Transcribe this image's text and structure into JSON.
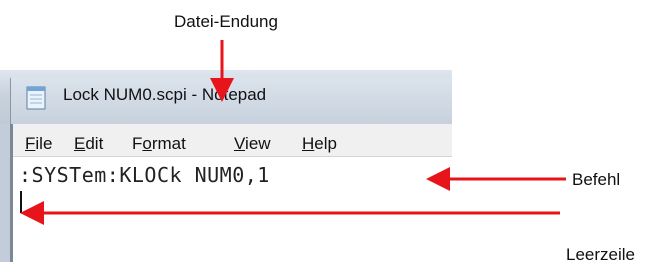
{
  "annotations": {
    "file_extension": "Datei-Endung",
    "command": "Befehl",
    "blank_line": "Leerzeile"
  },
  "window": {
    "title": "Lock NUM0.scpi - Notepad"
  },
  "menu": {
    "items": [
      {
        "accel": "F",
        "rest": "ile"
      },
      {
        "accel": "E",
        "rest": "dit"
      },
      {
        "pre": "F",
        "accel": "o",
        "rest": "rmat"
      },
      {
        "accel": "V",
        "rest": "iew"
      },
      {
        "accel": "H",
        "rest": "elp"
      }
    ]
  },
  "editor": {
    "line1": ":SYSTem:KLOCk NUM0,1",
    "line2": ""
  },
  "colors": {
    "arrow": "#e8141b"
  }
}
